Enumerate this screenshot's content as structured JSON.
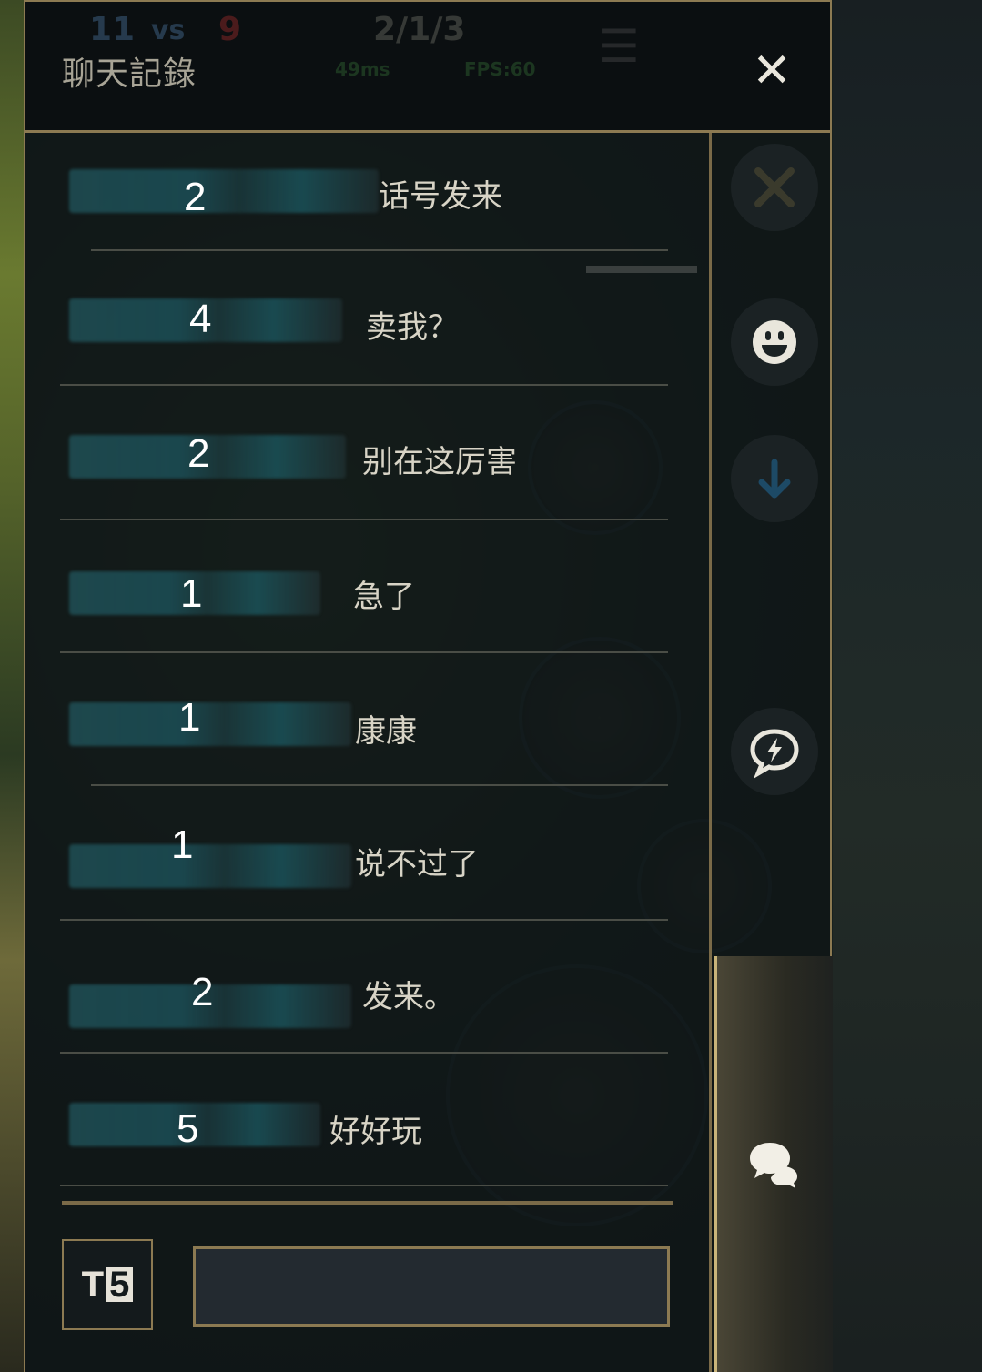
{
  "header": {
    "title": "聊天記錄",
    "close_icon": "close-icon",
    "hud": {
      "kills_blue": "11",
      "vs": "vs",
      "kills_red": "9",
      "kda": "2/1/3",
      "ping": "49ms",
      "fps": "FPS:60"
    }
  },
  "messages": [
    {
      "num": "2",
      "text": "话号发来"
    },
    {
      "num": "4",
      "text": "卖我？"
    },
    {
      "num": "2",
      "text": "别在这厉害"
    },
    {
      "num": "1",
      "text": "急了"
    },
    {
      "num": "1",
      "text": "康康"
    },
    {
      "num": "1",
      "text": "说不过了"
    },
    {
      "num": "2",
      "text": "发来。"
    },
    {
      "num": "5",
      "text": "好好玩"
    }
  ],
  "sidebar": {
    "items": [
      {
        "icon": "crossed-swords-icon"
      },
      {
        "icon": "emoji-icon"
      },
      {
        "icon": "scroll-down-icon"
      },
      {
        "icon": "quick-message-icon"
      },
      {
        "icon": "chat-bubbles-icon",
        "active": true
      }
    ]
  },
  "bottom": {
    "font_label": "T",
    "font_size": "5",
    "input_value": ""
  },
  "colors": {
    "frame_gold": "#8c7a52",
    "panel_bg": "#0e1416",
    "text": "#d8d4c6"
  }
}
